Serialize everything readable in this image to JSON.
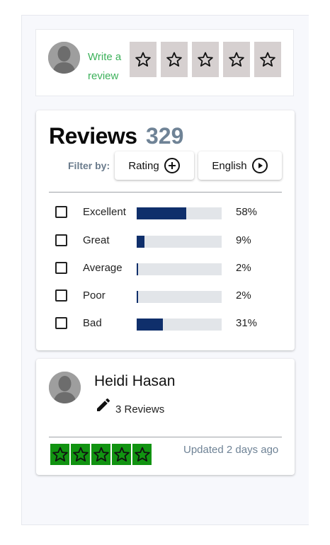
{
  "write_review": {
    "link_label": "Write a review",
    "star_count": 5
  },
  "reviews": {
    "title": "Reviews",
    "count": "329",
    "filter_label": "Filter by:",
    "filter_rating_label": "Rating",
    "filter_language_label": "English",
    "rows": [
      {
        "label": "Excellent",
        "percent": "58%",
        "fill": 0.58
      },
      {
        "label": "Great",
        "percent": "9%",
        "fill": 0.09
      },
      {
        "label": "Average",
        "percent": "2%",
        "fill": 0.02
      },
      {
        "label": "Poor",
        "percent": "2%",
        "fill": 0.02
      },
      {
        "label": "Bad",
        "percent": "31%",
        "fill": 0.31
      }
    ],
    "bar_color": "#0f2f6b"
  },
  "reviewer": {
    "name": "Heidi Hasan",
    "review_count": "3 Reviews",
    "rating": 5,
    "updated": "Updated 2 days ago",
    "star_color": "#119311"
  },
  "colors": {
    "accent_green": "#3cb15a",
    "count_gray": "#6f8396"
  }
}
